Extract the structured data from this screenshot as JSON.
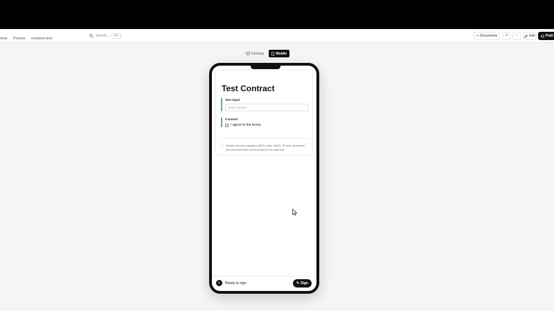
{
  "breadcrumb": {
    "part1": "mow",
    "part2": "Preview",
    "part3": "recipient view"
  },
  "search": {
    "placeholder": "Search...",
    "shortcut": "⌘K"
  },
  "toolbar": {
    "documents_label": "Documents",
    "undo_glyph": "↶",
    "redo_glyph": "↷",
    "edit_label": "Edit",
    "publish_label": "Publ"
  },
  "device_toggle": {
    "desktop_label": "Desktop",
    "mobile_label": "Mobile",
    "active": "Mobile"
  },
  "document": {
    "title": "Test Contract",
    "text_field": {
      "label": "Test input",
      "placeholder": "Enter answer"
    },
    "consent_field": {
      "label": "Consent",
      "checkbox_label": "I agree to the terms.",
      "checked": false
    },
    "notice": "Simple electronic signature (SES) under eIDAS. IP hash, timestamp and document hash are recorded for the audit trail."
  },
  "footer": {
    "status": "Ready to sign",
    "sign_label": "Sign"
  },
  "icons": {
    "search": "search-icon",
    "documents": "plus-icon",
    "edit": "pen-icon",
    "publish": "globe-icon",
    "desktop": "monitor-icon",
    "mobile": "phone-icon",
    "info": "info-icon",
    "sign": "pen-icon"
  },
  "colors": {
    "accent_bar": "#5aa9a6",
    "dark": "#111111",
    "background": "#f5f5f4"
  }
}
